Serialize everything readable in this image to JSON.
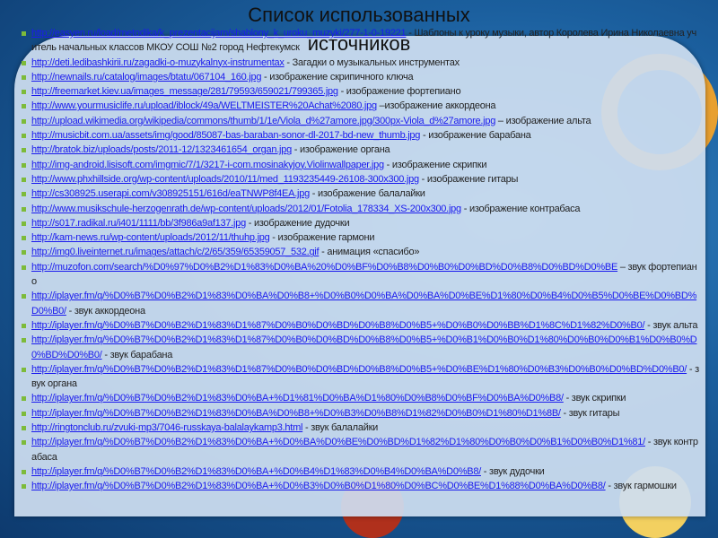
{
  "title": {
    "line1": "Список использованных",
    "line2": "источников"
  },
  "items": [
    {
      "url": "http://easyen.ru/load/metodika/k_prezentacijam/shablony_k_uroku_muzyki/277-1-0-19221",
      "text": " - Шаблоны к уроку музыки, автор Королева Ирина Николаевна учитель начальных классов МКОУ СОШ №2 город Нефтекумск"
    },
    {
      "url": "http://deti.ledibashkirii.ru/zagadki-o-muzykalnyx-instrumentax",
      "text": " - Загадки о музыкальных инструментах"
    },
    {
      "url": "http://newnails.ru/catalog/images/btatu/067104_160.jpg",
      "text": " - изображение скрипичного ключа"
    },
    {
      "url": "http://freemarket.kiev.ua/images_message/281/79593/659021/799365.jpg",
      "text": " - изображение фортепиано"
    },
    {
      "url": "http://www.yourmusiclife.ru/upload/iblock/49a/WELTMEISTER%20Achat%2080.jpg",
      "text": " –изображение аккордеона"
    },
    {
      "url": "http://upload.wikimedia.org/wikipedia/commons/thumb/1/1e/Viola_d%27amore.jpg/300px-Viola_d%27amore.jpg",
      "text": " – изображение альта"
    },
    {
      "url": "http://musicbit.com.ua/assets/img/good/85087-bas-baraban-sonor-dl-2017-bd-new_thumb.jpg",
      "text": " - изображение барабана"
    },
    {
      "url": "http://bratok.biz/uploads/posts/2011-12/1323461654_organ.jpg",
      "text": " - изображение органа"
    },
    {
      "url": "http://img-android.lisisoft.com/imgmic/7/1/3217-i-com.mosinakyjoy.Violinwallpaper.jpg",
      "text": " - изображение скрипки"
    },
    {
      "url": "http://www.phxhillside.org/wp-content/uploads/2010/11/med_1193235449-26108-300x300.jpg",
      "text": " - изображение гитары"
    },
    {
      "url": "http://cs308925.userapi.com/v308925151/616d/eaTNWP8f4EA.jpg",
      "text": " - изображение балалайки"
    },
    {
      "url": "http://www.musikschule-herzogenrath.de/wp-content/uploads/2012/01/Fotolia_178334_XS-200x300.jpg",
      "text": " - изображение контрабаса"
    },
    {
      "url": "http://s017.radikal.ru/i401/1111/bb/3f986a9af137.jpg",
      "text": " - изображение дудочки"
    },
    {
      "url": "http://kam-news.ru/wp-content/uploads/2012/11/thuhp.jpg",
      "text": "  - изображение гармони"
    },
    {
      "url": "http://img0.liveinternet.ru/images/attach/c/2/65/359/65359057_532.gif",
      "text": " - анимация «спасибо»"
    },
    {
      "url": "http://muzofon.com/search/%D0%97%D0%B2%D1%83%D0%BA%20%D0%BF%D0%B8%D0%B0%D0%BD%D0%B8%D0%BD%D0%BE",
      "text": " – звук фортепиано"
    },
    {
      "url": "http://iplayer.fm/q/%D0%B7%D0%B2%D1%83%D0%BA%D0%B8+%D0%B0%D0%BA%D0%BA%D0%BE%D1%80%D0%B4%D0%B5%D0%BE%D0%BD%D0%B0/",
      "text": " - звук аккордеона"
    },
    {
      "url": "http://iplayer.fm/q/%D0%B7%D0%B2%D1%83%D1%87%D0%B0%D0%BD%D0%B8%D0%B5+%D0%B0%D0%BB%D1%8C%D1%82%D0%B0/",
      "text": " - звук альта"
    },
    {
      "url": "http://iplayer.fm/q/%D0%B7%D0%B2%D1%83%D1%87%D0%B0%D0%BD%D0%B8%D0%B5+%D0%B1%D0%B0%D1%80%D0%B0%D0%B1%D0%B0%D0%BD%D0%B0/",
      "text": " - звук барабана"
    },
    {
      "url": "http://iplayer.fm/q/%D0%B7%D0%B2%D1%83%D1%87%D0%B0%D0%BD%D0%B8%D0%B5+%D0%BE%D1%80%D0%B3%D0%B0%D0%BD%D0%B0/",
      "text": " - звук органа"
    },
    {
      "url": "http://iplayer.fm/q/%D0%B7%D0%B2%D1%83%D0%BA+%D1%81%D0%BA%D1%80%D0%B8%D0%BF%D0%BA%D0%B8/",
      "text": " - звук скрипки"
    },
    {
      "url": "http://iplayer.fm/q/%D0%B7%D0%B2%D1%83%D0%BA%D0%B8+%D0%B3%D0%B8%D1%82%D0%B0%D1%80%D1%8B/",
      "text": " - звук гитары"
    },
    {
      "url": "http://ringtonclub.ru/zvuki-mp3/7046-russkaya-balalaykamp3.html",
      "text": " - звук балалайки"
    },
    {
      "url": "http://iplayer.fm/q/%D0%B7%D0%B2%D1%83%D0%BA+%D0%BA%D0%BE%D0%BD%D1%82%D1%80%D0%B0%D0%B1%D0%B0%D1%81/",
      "text": " - звук контрабаса"
    },
    {
      "url": "http://iplayer.fm/q/%D0%B7%D0%B2%D1%83%D0%BA+%D0%B4%D1%83%D0%B4%D0%BA%D0%B8/",
      "text": " - звук дудочки"
    },
    {
      "url": "http://iplayer.fm/q/%D0%B7%D0%B2%D1%83%D0%BA+%D0%B3%D0%B0%D1%80%D0%BC%D0%BE%D1%88%D0%BA%D0%B8/",
      "text": " - звук гармошки"
    }
  ]
}
